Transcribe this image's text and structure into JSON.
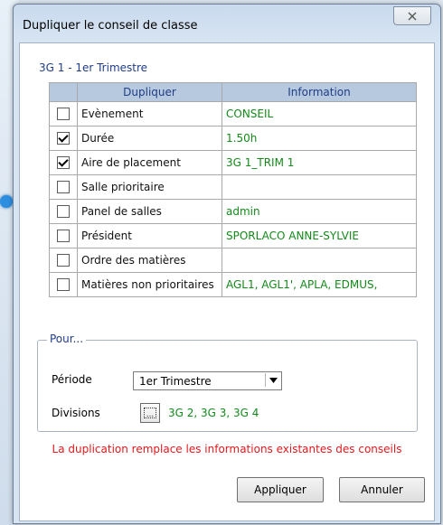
{
  "window": {
    "title": "Dupliquer le conseil de classe",
    "close_glyph": "⛝"
  },
  "context": "3G 1 - 1er Trimestre",
  "table": {
    "headers": [
      "",
      "Dupliquer",
      "Information"
    ],
    "rows": [
      {
        "checked": false,
        "label": "Evènement",
        "info": "CONSEIL"
      },
      {
        "checked": true,
        "label": "Durée",
        "info": "1.50h"
      },
      {
        "checked": true,
        "label": "Aire de placement",
        "info": "3G 1_TRIM 1"
      },
      {
        "checked": false,
        "label": "Salle prioritaire",
        "info": ""
      },
      {
        "checked": false,
        "label": "Panel de salles",
        "info": "admin"
      },
      {
        "checked": false,
        "label": "Président",
        "info": "SPORLACO ANNE-SYLVIE"
      },
      {
        "checked": false,
        "label": "Ordre des matières",
        "info": ""
      },
      {
        "checked": false,
        "label": "Matières non prioritaires",
        "info": "AGL1, AGL1', APLA, EDMUS,"
      }
    ]
  },
  "pour": {
    "legend": "Pour...",
    "periode_label": "Période",
    "periode_value": "1er Trimestre",
    "divisions_label": "Divisions",
    "divisions_value": "3G 2, 3G 3, 3G 4"
  },
  "warning": "La duplication remplace les informations existantes des conseils",
  "buttons": {
    "apply": "Appliquer",
    "cancel": "Annuler"
  }
}
